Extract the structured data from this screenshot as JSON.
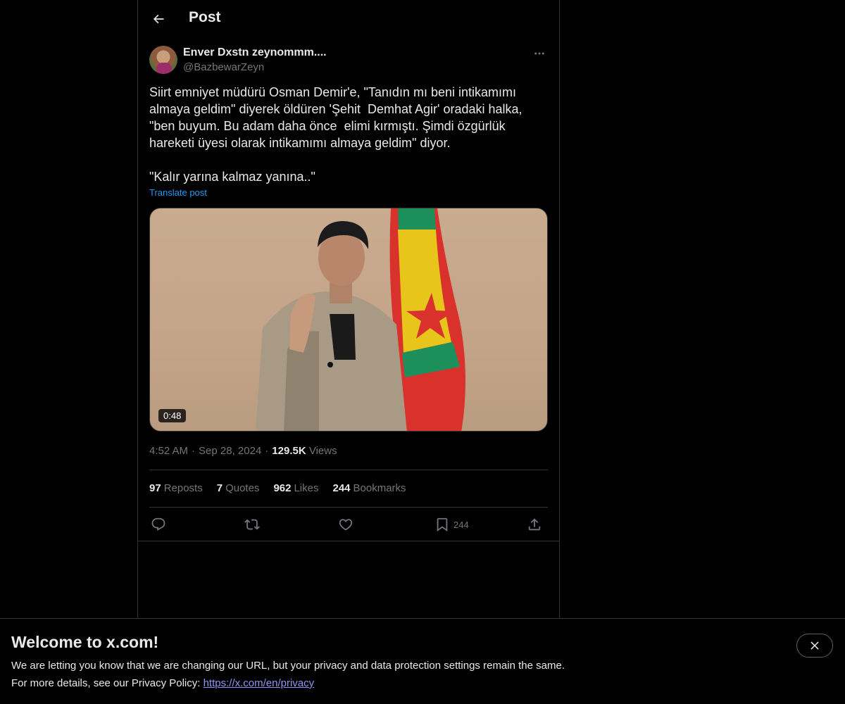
{
  "header": {
    "title": "Post"
  },
  "author": {
    "name": "Enver Dxstn zeynommm....",
    "handle": "@BazbewarZeyn"
  },
  "post": {
    "text": "Siirt emniyet müdürü Osman Demir'e, \"Tanıdın mı beni intikamımı\nalmaya geldim\" diyerek öldüren 'Şehit  Demhat Agir' oradaki halka,\n\"ben buyum. Bu adam daha önce  elimi kırmıştı. Şimdi özgürlük\nhareketi üyesi olarak intikamımı almaya geldim\" diyor.\n\n\"Kalır yarına kalmaz yanına..\"",
    "translate_label": "Translate post",
    "video_duration": "0:48",
    "time": "4:52 AM",
    "date": "Sep 28, 2024",
    "views_count": "129.5K",
    "views_label": "Views"
  },
  "stats": {
    "reposts_count": "97",
    "reposts_label": "Reposts",
    "quotes_count": "7",
    "quotes_label": "Quotes",
    "likes_count": "962",
    "likes_label": "Likes",
    "bookmarks_count": "244",
    "bookmarks_label": "Bookmarks"
  },
  "actions": {
    "bookmark_count": "244"
  },
  "icons": {
    "back": "arrow-left-icon",
    "more": "more-horizontal-icon",
    "reply": "reply-icon",
    "repost": "repost-icon",
    "like": "heart-icon",
    "bookmark": "bookmark-icon",
    "share": "share-icon",
    "close": "close-icon"
  },
  "colors": {
    "background": "#000000",
    "text": "#e7e9ea",
    "muted": "#71767b",
    "accent": "#1d9bf0",
    "border": "#2f3336"
  },
  "banner": {
    "title": "Welcome to x.com!",
    "line1": "We are letting you know that we are changing our URL, but your privacy and data protection settings remain the same.",
    "line2_prefix": "For more details, see our Privacy Policy: ",
    "link": "https://x.com/en/privacy"
  }
}
